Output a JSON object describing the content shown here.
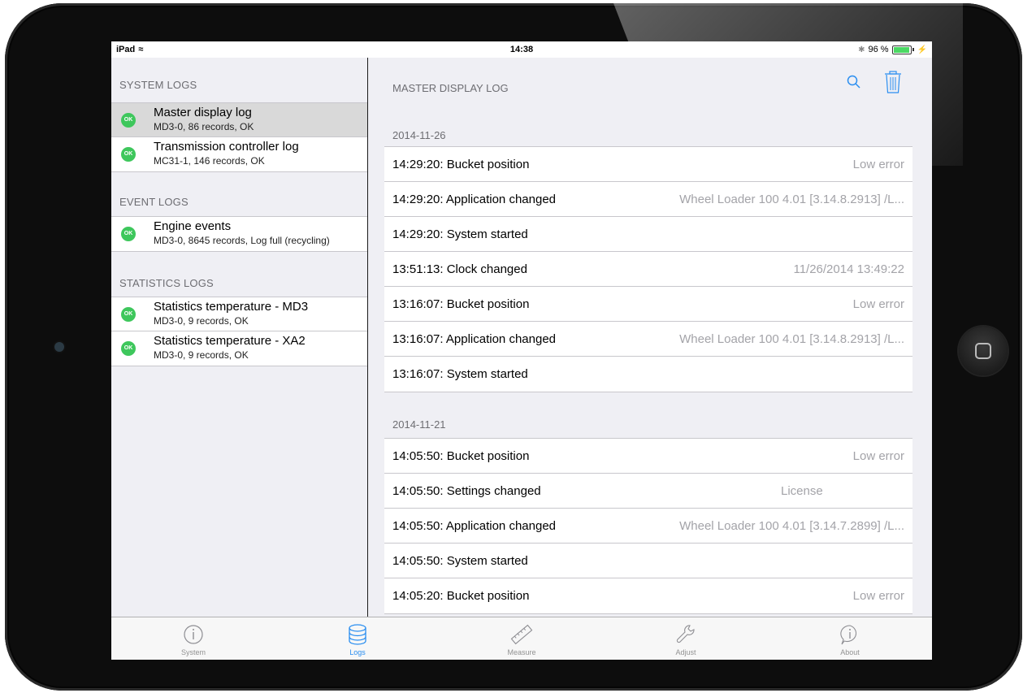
{
  "status_bar": {
    "device": "iPad",
    "time": "14:38",
    "battery": "96 %",
    "battery_level": 0.96
  },
  "sidebar": {
    "sections": [
      {
        "header": "SYSTEM LOGS",
        "items": [
          {
            "title": "Master display log",
            "subtitle": "MD3-0, 86 records, OK",
            "badge": "OK",
            "selected": true
          },
          {
            "title": "Transmission controller log",
            "subtitle": "MC31-1, 146 records, OK",
            "badge": "OK",
            "selected": false
          }
        ]
      },
      {
        "header": "EVENT LOGS",
        "items": [
          {
            "title": "Engine events",
            "subtitle": "MD3-0, 8645 records, Log full (recycling)",
            "badge": "OK",
            "selected": false
          }
        ]
      },
      {
        "header": "STATISTICS LOGS",
        "items": [
          {
            "title": "Statistics temperature - MD3",
            "subtitle": "MD3-0, 9 records, OK",
            "badge": "OK",
            "selected": false
          },
          {
            "title": "Statistics temperature - XA2",
            "subtitle": "MD3-0, 9 records, OK",
            "badge": "OK",
            "selected": false
          }
        ]
      }
    ]
  },
  "detail": {
    "title": "MASTER DISPLAY LOG",
    "groups": [
      {
        "date": "2014-11-26",
        "entries": [
          {
            "text": "14:29:20: Bucket position",
            "value": "Low error"
          },
          {
            "text": "14:29:20: Application changed",
            "value": "Wheel Loader 100 4.01 [3.14.8.2913] /L..."
          },
          {
            "text": "14:29:20: System started",
            "value": ""
          },
          {
            "text": "13:51:13: Clock changed",
            "value": "11/26/2014 13:49:22"
          },
          {
            "text": "13:16:07: Bucket position",
            "value": "Low error"
          },
          {
            "text": "13:16:07: Application changed",
            "value": "Wheel Loader 100 4.01 [3.14.8.2913] /L..."
          },
          {
            "text": "13:16:07: System started",
            "value": ""
          }
        ]
      },
      {
        "date": "2014-11-21",
        "entries": [
          {
            "text": "14:05:50: Bucket position",
            "value": "Low error"
          },
          {
            "text": "14:05:50: Settings changed",
            "value": "License"
          },
          {
            "text": "14:05:50: Application changed",
            "value": "Wheel Loader 100 4.01 [3.14.7.2899] /L..."
          },
          {
            "text": "14:05:50: System started",
            "value": ""
          },
          {
            "text": "14:05:20: Bucket position",
            "value": "Low error"
          }
        ]
      }
    ]
  },
  "tabbar": {
    "tabs": [
      {
        "label": "System",
        "icon": "info-circle-icon",
        "active": false
      },
      {
        "label": "Logs",
        "icon": "database-icon",
        "active": true
      },
      {
        "label": "Measure",
        "icon": "ruler-icon",
        "active": false
      },
      {
        "label": "Adjust",
        "icon": "wrench-icon",
        "active": false
      },
      {
        "label": "About",
        "icon": "info-bubble-icon",
        "active": false
      }
    ]
  },
  "colors": {
    "accent": "#2a8ef0",
    "ok_badge": "#3ec75c",
    "selected_row": "#d9d9d9"
  }
}
